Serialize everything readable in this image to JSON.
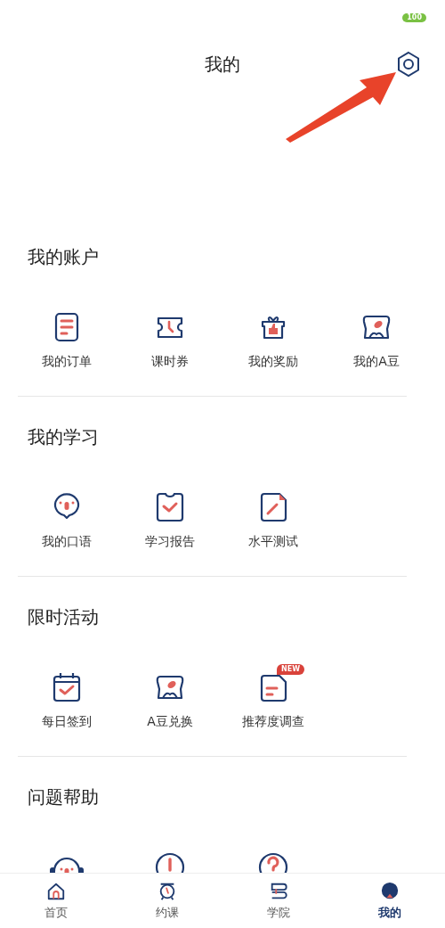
{
  "status_bar": {
    "battery": "100"
  },
  "header": {
    "title": "我的"
  },
  "sections": [
    {
      "title": "我的账户",
      "items": [
        {
          "label": "我的订单"
        },
        {
          "label": "课时券"
        },
        {
          "label": "我的奖励"
        },
        {
          "label": "我的A豆"
        }
      ]
    },
    {
      "title": "我的学习",
      "items": [
        {
          "label": "我的口语"
        },
        {
          "label": "学习报告"
        },
        {
          "label": "水平测试"
        }
      ]
    },
    {
      "title": "限时活动",
      "items": [
        {
          "label": "每日签到"
        },
        {
          "label": "A豆兑换"
        },
        {
          "label": "推荐度调查",
          "badge": "NEW"
        }
      ]
    },
    {
      "title": "问题帮助",
      "items": [
        {
          "kind": "cut"
        },
        {
          "kind": "cut"
        },
        {
          "kind": "cut"
        }
      ]
    }
  ],
  "tab_bar": [
    {
      "label": "首页",
      "selected": false
    },
    {
      "label": "约课",
      "selected": false
    },
    {
      "label": "学院",
      "selected": false
    },
    {
      "label": "我的",
      "selected": true
    }
  ]
}
